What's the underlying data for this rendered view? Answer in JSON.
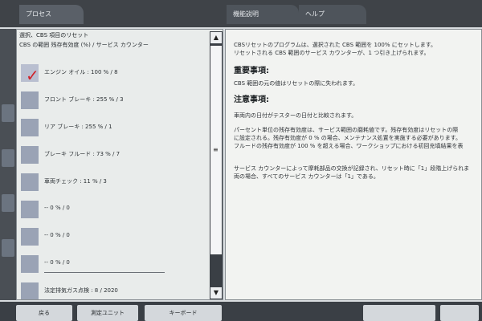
{
  "tabs": {
    "process": "プロセス",
    "function_desc": "機能説明",
    "help": "ヘルプ"
  },
  "left_panel": {
    "heading": "選択、CBS 項目のリセット",
    "subheading": "CBS の範囲  残存有効度 (%) / サービス カウンター",
    "items": [
      {
        "label": "エンジン オイル : 100 % / 8",
        "checked": true
      },
      {
        "label": "フロント ブレーキ : 255 % / 3",
        "checked": false
      },
      {
        "label": "リア ブレーキ : 255 % / 1",
        "checked": false
      },
      {
        "label": "ブレーキ フルード : 73 % / 7",
        "checked": false
      },
      {
        "label": "車両チェック : 11 % / 3",
        "checked": false
      },
      {
        "label": "-- 0 % / 0",
        "checked": false
      },
      {
        "label": "-- 0 % / 0",
        "checked": false
      },
      {
        "label": "-- 0 % / 0",
        "checked": false
      },
      {
        "label": "法定排気ガス点検 : 8 / 2020",
        "checked": false
      }
    ]
  },
  "right_panel": {
    "intro_line1": "CBSリセットのプログラムは、選択された CBS 範囲を 100% にセットします。",
    "intro_line2": "リセットされる CBS 範囲のサービス カウンターが、1 つ引き上げられます。",
    "heading_important": "重要事項:",
    "important_line1": "CBS 範囲の元の値はリセットの際に失われます。",
    "heading_note": "注意事項:",
    "note_line1": "車両内の日付がテスターの日付と比較されます。",
    "para1_line1": "パーセント単位の残存有効度は、サービス範囲の磨耗値です。残存有効度はリセットの際",
    "para1_line2": "に設定される。残存有効度が 0 % の場合、メンテナンス処置を実施する必要があります。",
    "para1_line3": "フルードの残存有効度が 100 % を超える場合、ワークショップにおける初回充填結果を表",
    "para2_line1": "サービス カウンターによって摩耗部品の交換が記録され、リセット時に「1」段階上げられま",
    "para2_line2": "両の場合、すべてのサービス カウンターは「1」である。"
  },
  "bottom": {
    "back": "戻る",
    "measure": "測定ユニット",
    "keyboard": "キーボード",
    "next": "",
    "end": ""
  },
  "icons": {
    "check": "✓",
    "scroll_up": "▲",
    "scroll_down": "▼",
    "grip": "≡"
  }
}
